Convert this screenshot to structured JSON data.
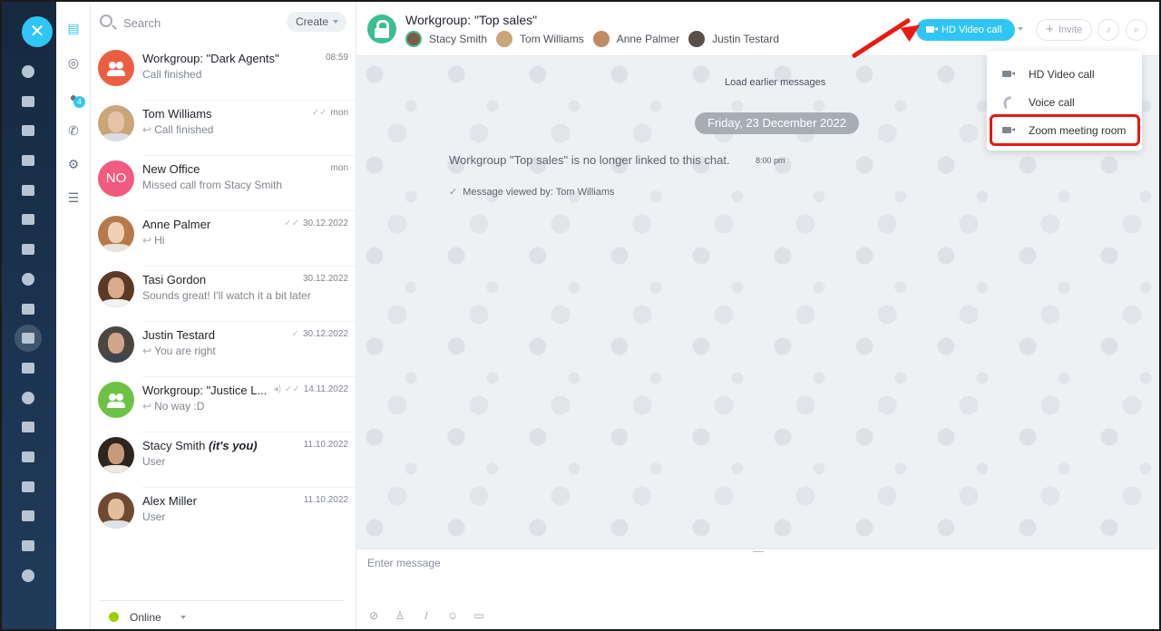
{
  "nav": {
    "badge_count": "4"
  },
  "list": {
    "search_placeholder": "Search",
    "create_label": "Create",
    "items": [
      {
        "name": "Workgroup: \"Dark Agents\"",
        "sub": "Call finished",
        "time": "08:59",
        "avatar": "group-orange"
      },
      {
        "name": "Tom Williams",
        "sub": "Call finished",
        "time": "mon",
        "avatar": "photo"
      },
      {
        "name": "New Office",
        "sub": "Missed call from Stacy Smith",
        "time": "mon",
        "avatar": "initials",
        "initials": "NO"
      },
      {
        "name": "Anne Palmer",
        "sub": "Hi",
        "time": "30.12.2022",
        "avatar": "photo"
      },
      {
        "name": "Tasi Gordon",
        "sub": "Sounds great! I'll watch it a bit later",
        "time": "30.12.2022",
        "avatar": "photo"
      },
      {
        "name": "Justin Testard",
        "sub": "You are right",
        "time": "30.12.2022",
        "avatar": "photo"
      },
      {
        "name": "Workgroup: \"Justice L...",
        "sub": "No way :D",
        "time": "14.11.2022",
        "avatar": "group-green"
      },
      {
        "name": "Stacy Smith",
        "name_suffix": "(it's you)",
        "sub": "User",
        "time": "11.10.2022",
        "avatar": "photo"
      },
      {
        "name": "Alex Miller",
        "sub": "User",
        "time": "11.10.2022",
        "avatar": "photo"
      }
    ],
    "status": "Online"
  },
  "chat": {
    "title": "Workgroup: \"Top sales\"",
    "members": [
      "Stacy Smith",
      "Tom Williams",
      "Anne Palmer",
      "Justin Testard"
    ],
    "video_call_label": "HD Video call",
    "invite_label": "Invite",
    "load_earlier": "Load earlier messages",
    "date": "Friday, 23 December 2022",
    "system_message": "Workgroup \"Top sales\" is no longer linked to this chat.",
    "system_time": "8:00 pm",
    "viewed_by": "Message viewed by: Tom Williams",
    "input_placeholder": "Enter message"
  },
  "dropdown": {
    "items": [
      "HD Video call",
      "Voice call",
      "Zoom meeting room"
    ]
  },
  "colors": {
    "accent": "#2fc6f6",
    "highlight_box": "#e8170c",
    "online": "#9dcf00"
  }
}
